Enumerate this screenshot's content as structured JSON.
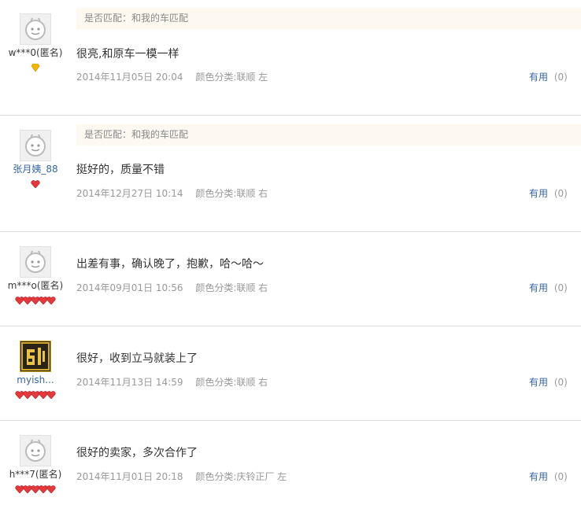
{
  "reviews": [
    {
      "user": "w***0(匿名)",
      "match": "是否匹配：和我的车匹配",
      "content": "很亮,和原车一模一样",
      "date": "2014年11月05日 20:04",
      "sku": "颜色分类:联顺 左",
      "useful_label": "有用",
      "useful_count": "(0)",
      "rank_icon": "gold-diamond-icon",
      "rank_count": 1
    },
    {
      "user": "张月姨_88",
      "match": "是否匹配：和我的车匹配",
      "content": "挺好的，质量不错",
      "date": "2014年12月27日 10:14",
      "sku": "颜色分类:联顺 右",
      "useful_label": "有用",
      "useful_count": "(0)",
      "rank_icon": "red-heart-icon",
      "rank_count": 1
    },
    {
      "user": "m***o(匿名)",
      "match": "",
      "content": "出差有事，确认晚了，抱歉，哈～哈～",
      "date": "2014年09月01日 10:56",
      "sku": "颜色分类:联顺 右",
      "useful_label": "有用",
      "useful_count": "(0)",
      "rank_icon": "red-heart-icon",
      "rank_count": 5
    },
    {
      "user": "myish...",
      "match": "",
      "content": "很好，收到立马就装上了",
      "date": "2014年11月13日 14:59",
      "sku": "颜色分类:联顺 右",
      "useful_label": "有用",
      "useful_count": "(0)",
      "rank_icon": "red-heart-icon",
      "rank_count": 5
    },
    {
      "user": "h***7(匿名)",
      "match": "",
      "content": "很好的卖家，多次合作了",
      "date": "2014年11月01日 20:18",
      "sku": "颜色分类:庆铃正厂 左",
      "useful_label": "有用",
      "useful_count": "(0)",
      "rank_icon": "red-heart-icon",
      "rank_count": 5
    }
  ],
  "colors": {
    "link": "#3566a6",
    "muted": "#999999",
    "match_bg": "#fdf8f0",
    "divider": "#dcdcdc"
  }
}
